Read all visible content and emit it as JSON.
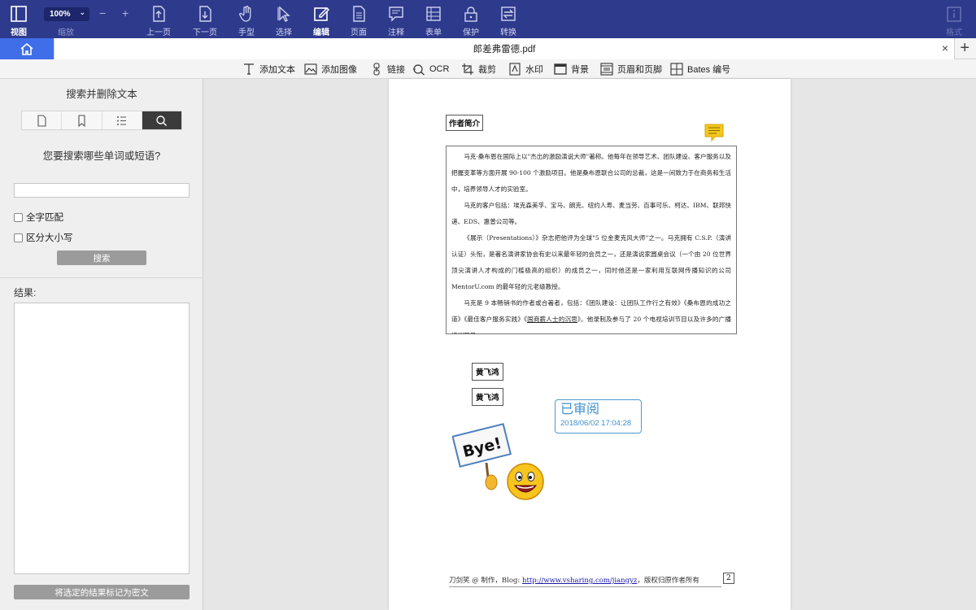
{
  "toolbar": {
    "view_label": "视图",
    "zoom_value": "100%",
    "zoom_label": "缩放",
    "zoom_minus": "−",
    "zoom_plus": "+",
    "prev_label": "上一页",
    "next_label": "下一页",
    "hand_label": "手型",
    "select_label": "选择",
    "edit_label": "编辑",
    "page_label": "页面",
    "annotate_label": "注释",
    "form_label": "表单",
    "protect_label": "保护",
    "convert_label": "转换",
    "format_label": "格式",
    "active_item": "编辑",
    "background_color": "#2e3a8c"
  },
  "tabs": {
    "document_title": "郎差弗雷德.pdf",
    "close": "×",
    "add": "+"
  },
  "edit_toolbar": {
    "add_text": "添加文本",
    "add_image": "添加图像",
    "link": "链接",
    "ocr": "OCR",
    "crop": "裁剪",
    "watermark": "水印",
    "background": "背景",
    "header_footer": "页眉和页脚",
    "bates": "Bates 编号"
  },
  "sidebar": {
    "title": "搜索并删除文本",
    "question": "您要搜索哪些单词或短语?",
    "search_value": "",
    "whole_word": "全字匹配",
    "case_sensitive": "区分大小写",
    "search_button": "搜索",
    "results_label": "结果:",
    "mark_button": "将选定的结果标记为密文"
  },
  "document": {
    "author_heading": "作者简介",
    "para1": "马克·桑布恩在国际上以\"杰出的激励演说大师\"著称。他每年在领导艺术、团队建设、客户服务以及把握变革等方面开展 90-100 个激励项目。他是桑布恩联合公司的总裁，这是一间致力于在商务和生活中，培养领导人才的实验室。",
    "para2": "马克的客户包括：埃克森美孚、宝马、朗克、纽约人寿、麦当劳、百事可乐、柯达、IBM、联邦快递、EDS、惠普公司等。",
    "para3": "《展示（Presentations）》杂志把他评为全球\"5 位金麦克风大师\"之一。马克拥有 C.S.P.（演讲认证）头衔，是著名演讲家协会有史以来最年轻的会员之一，还是演说家圆桌会议（一个由 20 位世界顶尖演讲人才构成的门槛极高的组织）的成员之一，同时他还是一家利用互联网传播知识的公司 MentorU.com 的最年轻的元老级教授。",
    "para4_a": "马克是 9 本畅销书的作者或合著者，包括：《团队建设：让团队工作行之有效》《桑布恩的成功之道》《最佳客户服务实践》《",
    "para4_link": "国商薪人士的沉思",
    "para4_b": "》。他录制及参与了 20 个电视培训节目以及许多的广播培训节目。",
    "signature_1": "黄飞鸿",
    "signature_2": "黄飞鸿",
    "stamp_title": "已审阅",
    "stamp_date": "2018/06/02 17:04:28",
    "sticker_text": "Bye!",
    "footer_prefix": "刀剑笑 @ 制作，Blog: ",
    "footer_link": "http://www.vsharing.com/jiangyz",
    "footer_suffix": "，版权归原作者所有",
    "page_number": "2"
  }
}
